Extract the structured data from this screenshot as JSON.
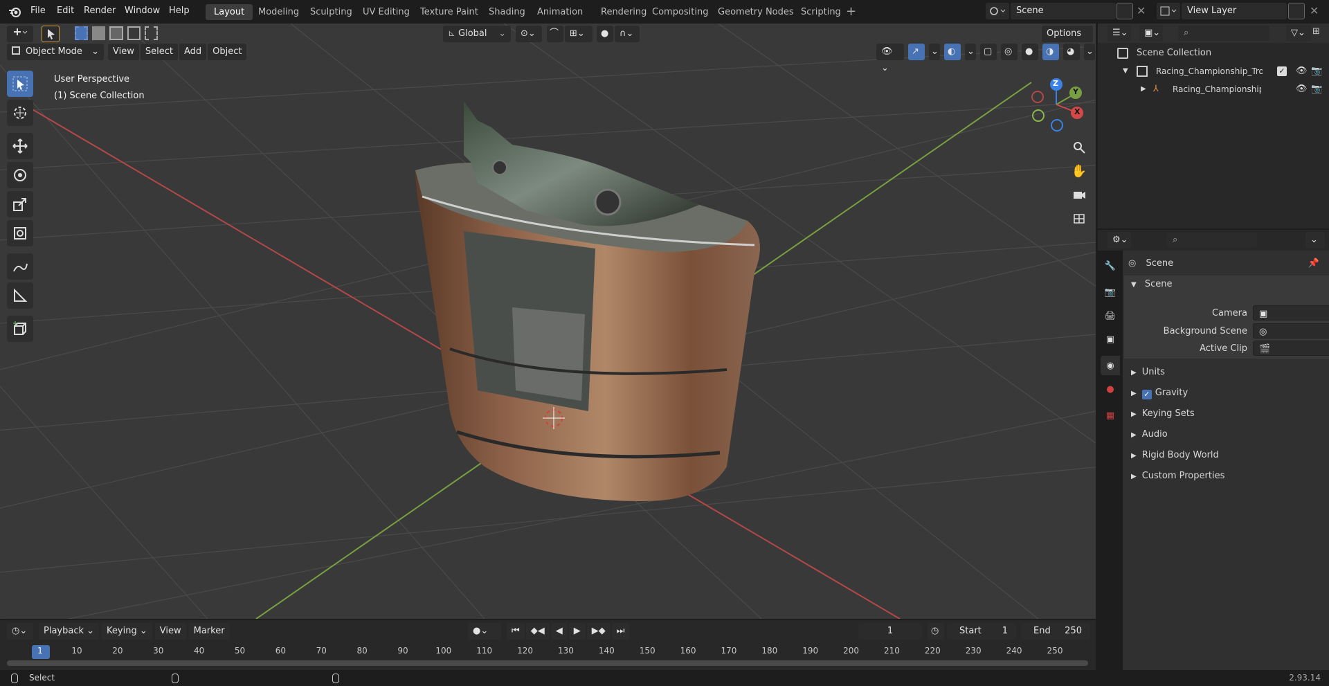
{
  "menus": [
    "File",
    "Edit",
    "Render",
    "Window",
    "Help"
  ],
  "workspaces": [
    "Layout",
    "Modeling",
    "Sculpting",
    "UV Editing",
    "Texture Paint",
    "Shading",
    "Animation",
    "Rendering",
    "Compositing",
    "Geometry Nodes",
    "Scripting"
  ],
  "scene_field": "Scene",
  "view_layer_field": "View Layer",
  "viewport": {
    "mode": "Object Mode",
    "header_menus": [
      "View",
      "Select",
      "Add",
      "Object"
    ],
    "orientation": "Global",
    "options_label": "Options",
    "overlay_line1": "User Perspective",
    "overlay_line2": "(1) Scene Collection",
    "gizmo": {
      "z": "Z",
      "y": "Y",
      "x": "X"
    }
  },
  "outliner": {
    "root": "Scene Collection",
    "items": [
      "Racing_Championship_Trophy",
      "Racing_Championship_Tr"
    ]
  },
  "properties": {
    "context": "Scene",
    "panel_title": "Scene",
    "rows": [
      {
        "label": "Camera"
      },
      {
        "label": "Background Scene"
      },
      {
        "label": "Active Clip"
      }
    ],
    "subpanels": [
      "Units",
      "Gravity",
      "Keying Sets",
      "Audio",
      "Rigid Body World",
      "Custom Properties"
    ],
    "gravity_checked": true
  },
  "timeline": {
    "menus": [
      "Playback",
      "Keying",
      "View",
      "Marker"
    ],
    "current_frame": "1",
    "start_label": "Start",
    "start_value": "1",
    "end_label": "End",
    "end_value": "250",
    "ticks": [
      "1",
      "10",
      "20",
      "30",
      "40",
      "50",
      "60",
      "70",
      "80",
      "90",
      "100",
      "110",
      "120",
      "130",
      "140",
      "150",
      "160",
      "170",
      "180",
      "190",
      "200",
      "210",
      "220",
      "230",
      "240",
      "250"
    ]
  },
  "status": {
    "left": "Select",
    "version": "2.93.14"
  },
  "colors": {
    "accent": "#4772b3",
    "x_axis": "#b34848",
    "y_axis": "#78a040",
    "z_gizmo": "#3c82e6"
  }
}
